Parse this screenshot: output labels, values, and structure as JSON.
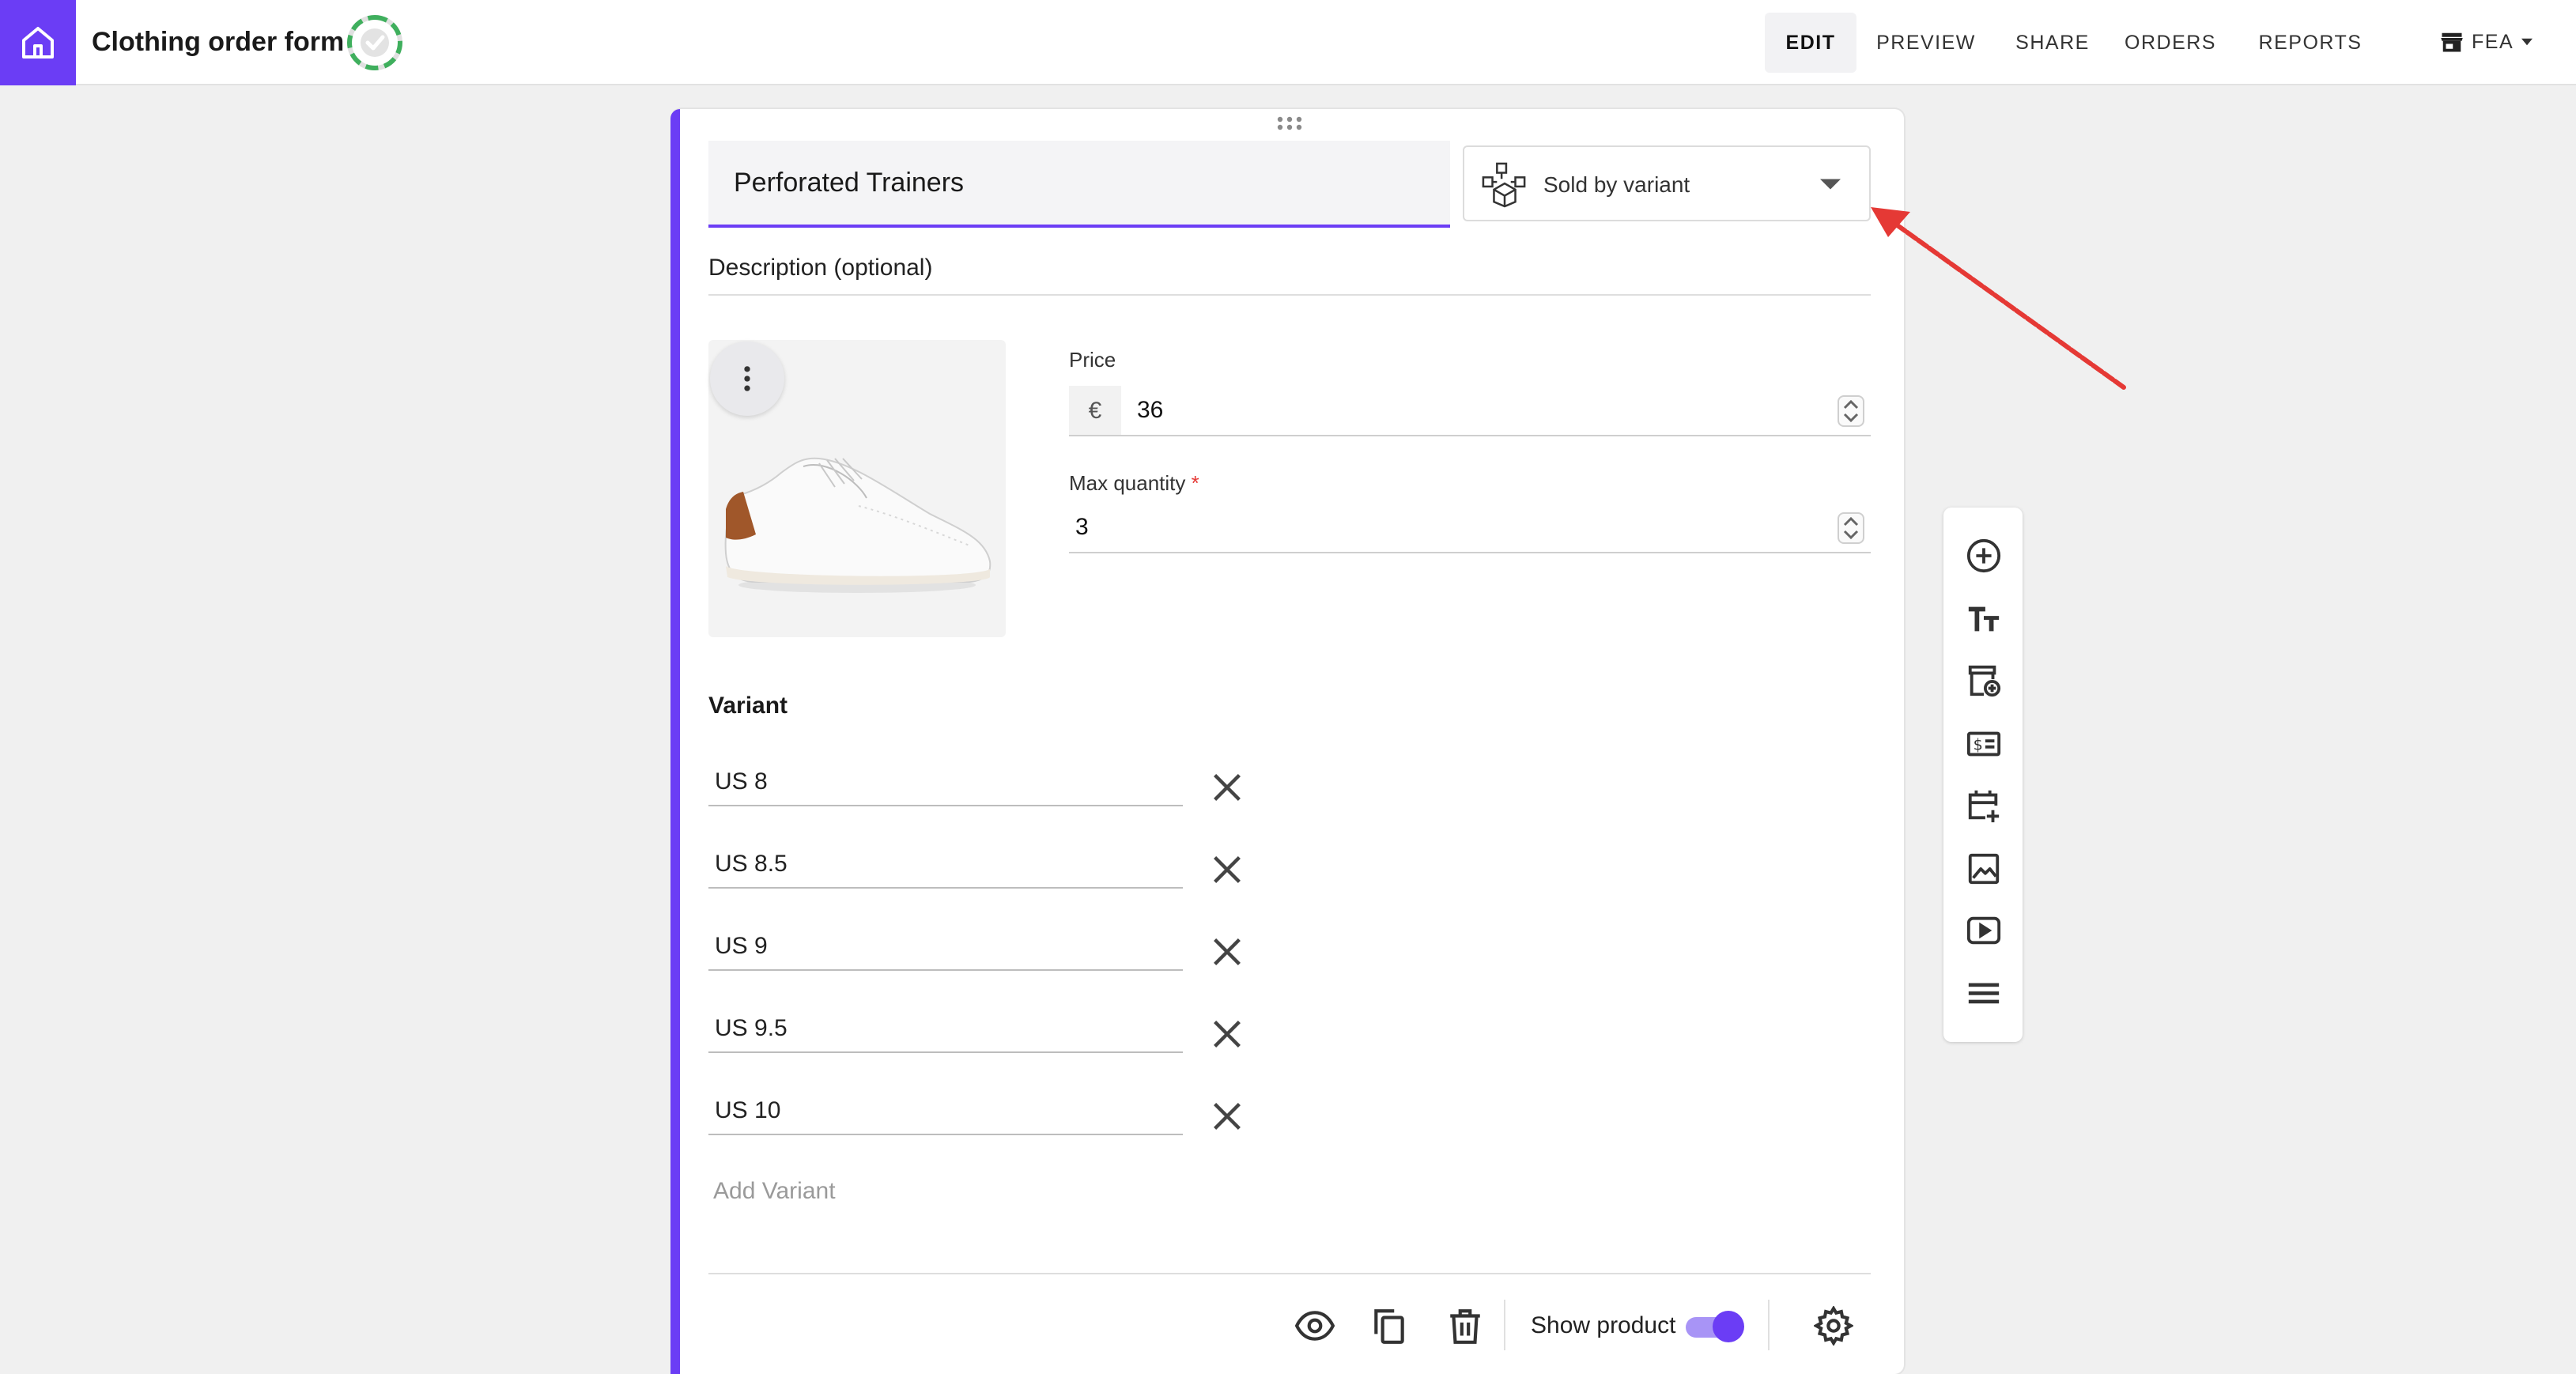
{
  "topbar": {
    "form_title": "Clothing order form",
    "nav": [
      {
        "label": "EDIT",
        "active": true
      },
      {
        "label": "PREVIEW",
        "active": false
      },
      {
        "label": "SHARE",
        "active": false
      },
      {
        "label": "ORDERS",
        "active": false
      },
      {
        "label": "REPORTS",
        "active": false
      }
    ],
    "store_label": "FEA",
    "icons": {
      "home": "home-icon",
      "status": "saved-status-icon",
      "store": "store-icon",
      "store_caret": "caret-down-icon"
    },
    "accent_color": "#6b3df5"
  },
  "product": {
    "name": "Perforated Trainers",
    "sold_by": "Sold by variant",
    "description_placeholder": "Description (optional)",
    "image": "white-sneaker-image",
    "price_label": "Price",
    "currency": "€",
    "price": "36",
    "max_quantity_label": "Max quantity",
    "required_mark": "*",
    "max_quantity": "3"
  },
  "variants": {
    "title": "Variant",
    "items": [
      "US 8",
      "US 8.5",
      "US 9",
      "US 9.5",
      "US 10"
    ],
    "add_placeholder": "Add Variant"
  },
  "footer": {
    "show_product_label": "Show product",
    "show_product_on": true,
    "icons": [
      "eye-icon",
      "copy-icon",
      "trash-icon",
      "gear-icon"
    ]
  },
  "toolbar": {
    "icons": [
      "add-circle-icon",
      "text-icon",
      "add-product-icon",
      "price-tag-icon",
      "add-event-icon",
      "image-icon",
      "video-icon",
      "section-divider-icon"
    ]
  },
  "annotation": {
    "color": "#e53935"
  }
}
